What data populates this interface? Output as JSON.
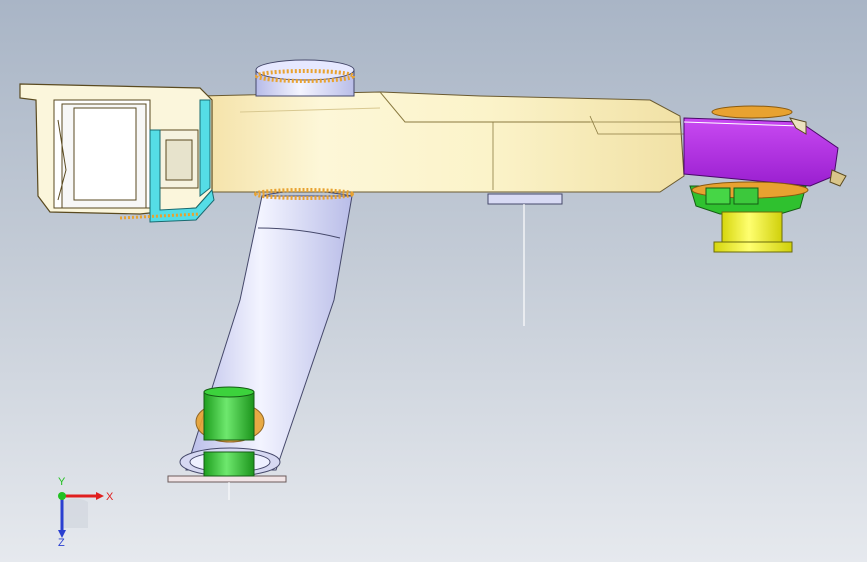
{
  "viewport": {
    "background_top": "#a9b5c6",
    "background_bottom": "#e6e9ee"
  },
  "model": {
    "colors": {
      "arm_body": "#fbf3c9",
      "arm_shadow": "#e9d9a0",
      "tube": "#cdd0f0",
      "cyan_bracket": "#55dde6",
      "purple_part": "#b22ee6",
      "green_parts": "#2fc12f",
      "yellow_bushing": "#f2f216",
      "weld_beads": "#e8a230"
    }
  },
  "triad": {
    "x_label": "X",
    "y_label": "Y",
    "z_label": "Z",
    "x_color": "#e01f1f",
    "y_color": "#22c022",
    "z_color": "#2a3fd0"
  }
}
